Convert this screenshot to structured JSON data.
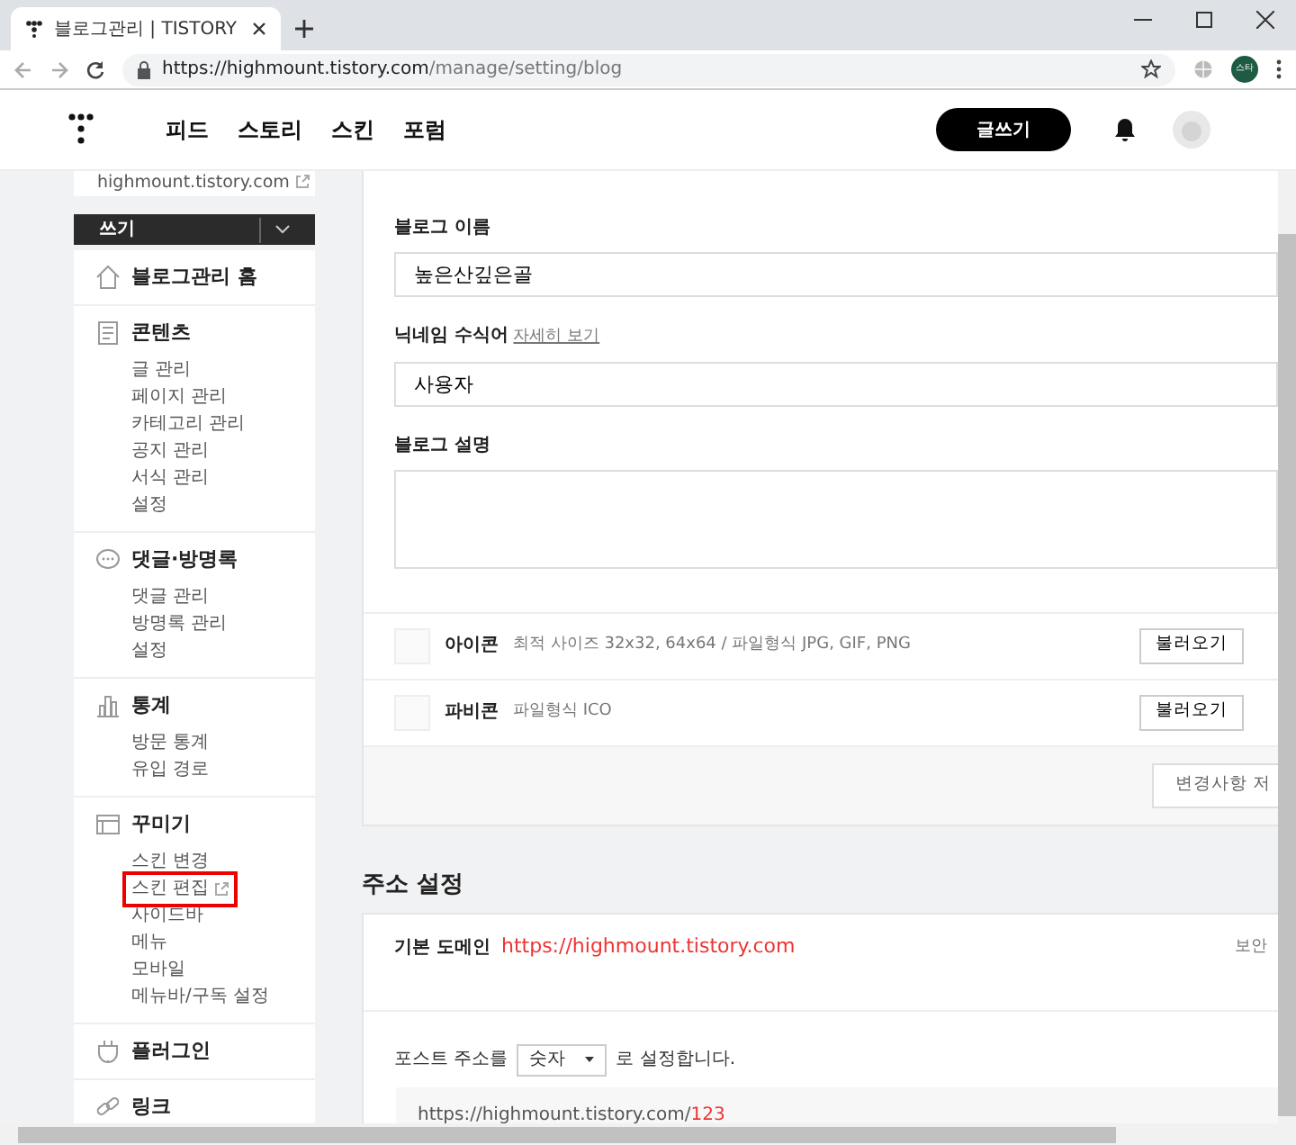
{
  "browser": {
    "tab_title": "블로그관리 | TISTORY",
    "url_host": "https://highmount.tistory.com",
    "url_path": "/manage/setting/blog",
    "profile": "스타"
  },
  "header": {
    "nav": [
      "피드",
      "스토리",
      "스킨",
      "포럼"
    ],
    "write_button": "글쓰기"
  },
  "sidebar": {
    "blog_url": "highmount.tistory.com",
    "write_button": "쓰기",
    "sections": [
      {
        "title": "블로그관리 홈"
      },
      {
        "title": "콘텐츠",
        "items": [
          {
            "label": "글 관리",
            "external": false,
            "highlighted": false
          },
          {
            "label": "페이지 관리",
            "external": false,
            "highlighted": false
          },
          {
            "label": "카테고리 관리",
            "external": false,
            "highlighted": false
          },
          {
            "label": "공지 관리",
            "external": false,
            "highlighted": false
          },
          {
            "label": "서식 관리",
            "external": false,
            "highlighted": false
          },
          {
            "label": "설정",
            "external": false,
            "highlighted": false
          }
        ]
      },
      {
        "title": "댓글·방명록",
        "items": [
          {
            "label": "댓글 관리",
            "external": false,
            "highlighted": false
          },
          {
            "label": "방명록 관리",
            "external": false,
            "highlighted": false
          },
          {
            "label": "설정",
            "external": false,
            "highlighted": false
          }
        ]
      },
      {
        "title": "통계",
        "items": [
          {
            "label": "방문 통계",
            "external": false,
            "highlighted": false
          },
          {
            "label": "유입 경로",
            "external": false,
            "highlighted": false
          }
        ]
      },
      {
        "title": "꾸미기",
        "items": [
          {
            "label": "스킨 변경",
            "external": false,
            "highlighted": false
          },
          {
            "label": "스킨 편집",
            "external": true,
            "highlighted": true
          },
          {
            "label": "사이드바",
            "external": false,
            "highlighted": false
          },
          {
            "label": "메뉴",
            "external": false,
            "highlighted": false
          },
          {
            "label": "모바일",
            "external": false,
            "highlighted": false
          },
          {
            "label": "메뉴바/구독 설정",
            "external": false,
            "highlighted": false
          }
        ]
      },
      {
        "title": "플러그인"
      },
      {
        "title": "링크"
      }
    ]
  },
  "blog_settings": {
    "fields": [
      {
        "kind": "input",
        "label": "블로그 이름",
        "value": "높은산깊은골"
      },
      {
        "kind": "input",
        "label": "닉네임 수식어",
        "link": "자세히 보기",
        "value": "사용자"
      },
      {
        "kind": "textarea",
        "label": "블로그 설명"
      }
    ],
    "uploads": [
      {
        "label": "아이콘",
        "hint": "최적 사이즈 32x32, 64x64 / 파일형식 JPG, GIF, PNG",
        "button": "불러오기"
      },
      {
        "label": "파비콘",
        "hint": "파일형식 ICO",
        "button": "불러오기"
      }
    ],
    "save_button": "변경사항 저"
  },
  "address_settings": {
    "title": "주소 설정",
    "domain_label": "기본 도메인",
    "domain": "https://highmount.tistory.com",
    "security": "보안",
    "post_prefix": "포스트 주소를",
    "post_format": "숫자",
    "post_suffix": "로 설정합니다.",
    "example_base": "https://highmount.tistory.com/",
    "example_id": "123"
  }
}
